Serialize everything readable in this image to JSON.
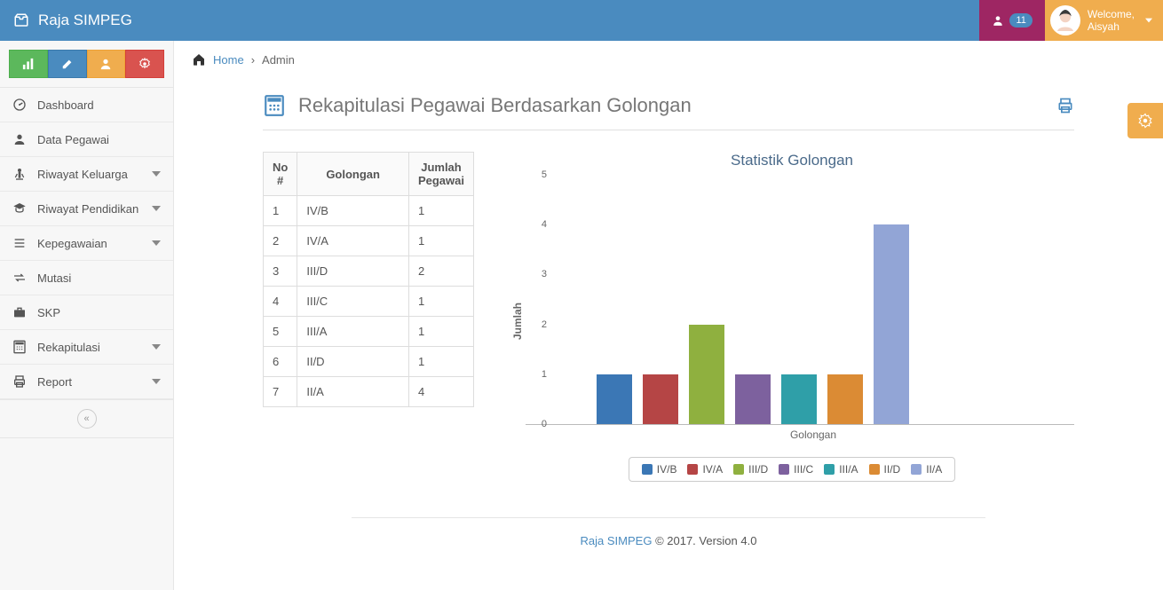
{
  "brand": "Raja SIMPEG",
  "user": {
    "welcome": "Welcome,",
    "name": "Aisyah",
    "notif_count": "11"
  },
  "breadcrumb": {
    "home": "Home",
    "current": "Admin"
  },
  "page": {
    "title": "Rekapitulasi Pegawai Berdasarkan Golongan"
  },
  "sidebar": {
    "items": [
      {
        "label": "Dashboard",
        "expandable": false
      },
      {
        "label": "Data Pegawai",
        "expandable": false
      },
      {
        "label": "Riwayat Keluarga",
        "expandable": true
      },
      {
        "label": "Riwayat Pendidikan",
        "expandable": true
      },
      {
        "label": "Kepegawaian",
        "expandable": true
      },
      {
        "label": "Mutasi",
        "expandable": false
      },
      {
        "label": "SKP",
        "expandable": false
      },
      {
        "label": "Rekapitulasi",
        "expandable": true
      },
      {
        "label": "Report",
        "expandable": true
      }
    ]
  },
  "table": {
    "headers": {
      "no": "No #",
      "gol": "Golongan",
      "jml": "Jumlah Pegawai"
    },
    "rows": [
      {
        "no": "1",
        "gol": "IV/B",
        "jml": "1"
      },
      {
        "no": "2",
        "gol": "IV/A",
        "jml": "1"
      },
      {
        "no": "3",
        "gol": "III/D",
        "jml": "2"
      },
      {
        "no": "4",
        "gol": "III/C",
        "jml": "1"
      },
      {
        "no": "5",
        "gol": "III/A",
        "jml": "1"
      },
      {
        "no": "6",
        "gol": "II/D",
        "jml": "1"
      },
      {
        "no": "7",
        "gol": "II/A",
        "jml": "4"
      }
    ]
  },
  "footer": {
    "brand": "Raja SIMPEG",
    "text": " © 2017. Version 4.0"
  },
  "chart_data": {
    "type": "bar",
    "title": "Statistik Golongan",
    "xlabel": "Golongan",
    "ylabel": "Jumlah",
    "ylim": [
      0,
      5
    ],
    "categories": [
      "IV/B",
      "IV/A",
      "III/D",
      "III/C",
      "III/A",
      "II/D",
      "II/A"
    ],
    "values": [
      1,
      1,
      2,
      1,
      1,
      1,
      4
    ],
    "colors": [
      "#3b77b5",
      "#b54545",
      "#8fb03f",
      "#7d619e",
      "#2f9fa8",
      "#db8b34",
      "#92a5d6"
    ]
  }
}
